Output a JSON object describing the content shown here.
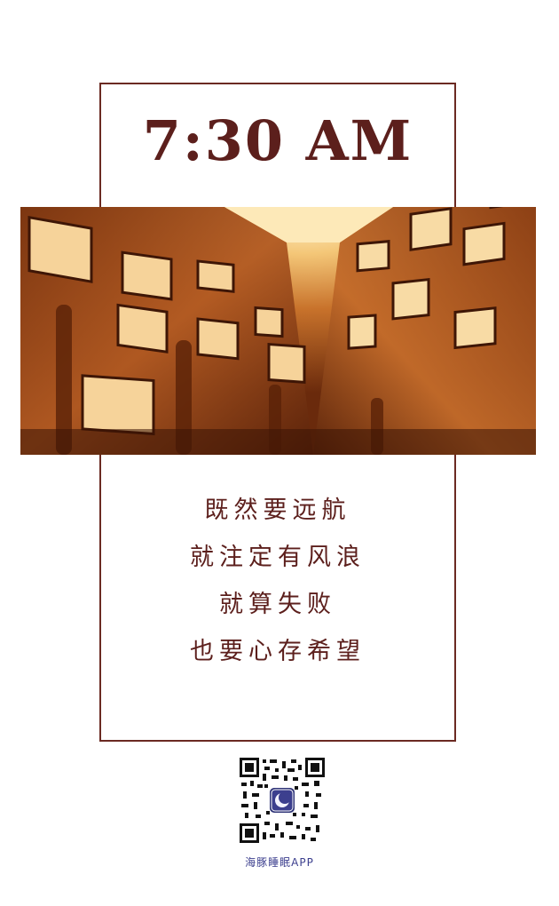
{
  "poster": {
    "time": "7:30 AM",
    "quote_lines": [
      "既然要远航",
      "就注定有风浪",
      "就算失败",
      "也要心存希望"
    ],
    "app_name": "海豚睡眠APP",
    "colors": {
      "accent": "#5c1f1c",
      "frame": "#6b2a22",
      "brand": "#3c3f8e"
    },
    "photo_subject": "building-courtyard-photo",
    "qr_logo_icon": "moon-icon"
  }
}
